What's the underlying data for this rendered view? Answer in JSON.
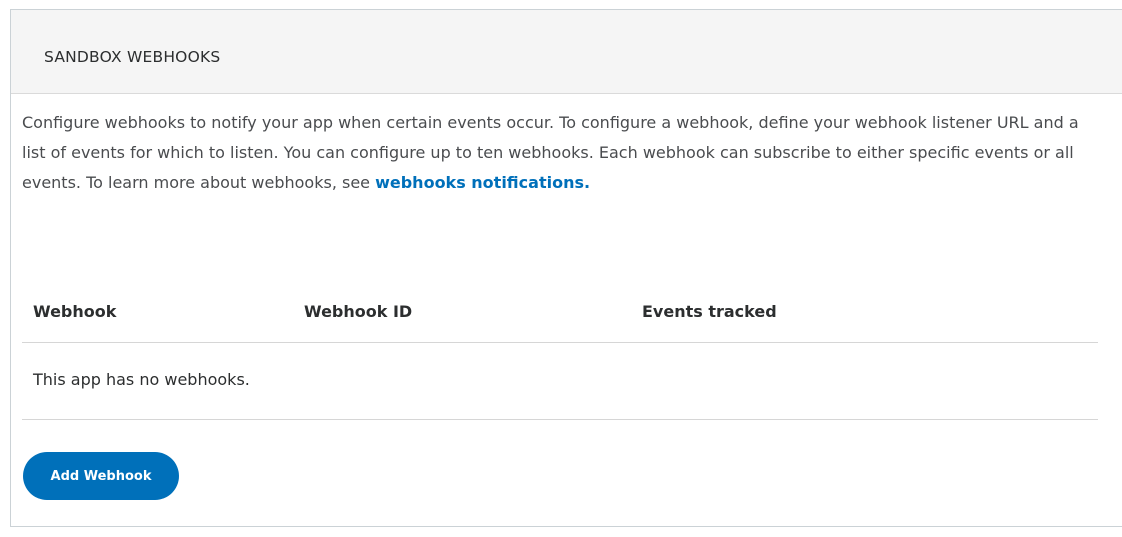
{
  "panel": {
    "title": "SANDBOX WEBHOOKS"
  },
  "description": {
    "text": "Configure webhooks to notify your app when certain events occur. To configure a webhook, define your webhook listener URL and a list of events for which to listen. You can configure up to ten webhooks. Each webhook can subscribe to either specific events or all events. To learn more about webhooks, see ",
    "link_label": "webhooks notifications."
  },
  "table": {
    "columns": [
      "Webhook",
      "Webhook ID",
      "Events tracked"
    ],
    "empty_message": "This app has no webhooks."
  },
  "actions": {
    "add_label": "Add Webhook"
  },
  "colors": {
    "accent": "#0070ba",
    "header_bg": "#f5f5f5"
  }
}
